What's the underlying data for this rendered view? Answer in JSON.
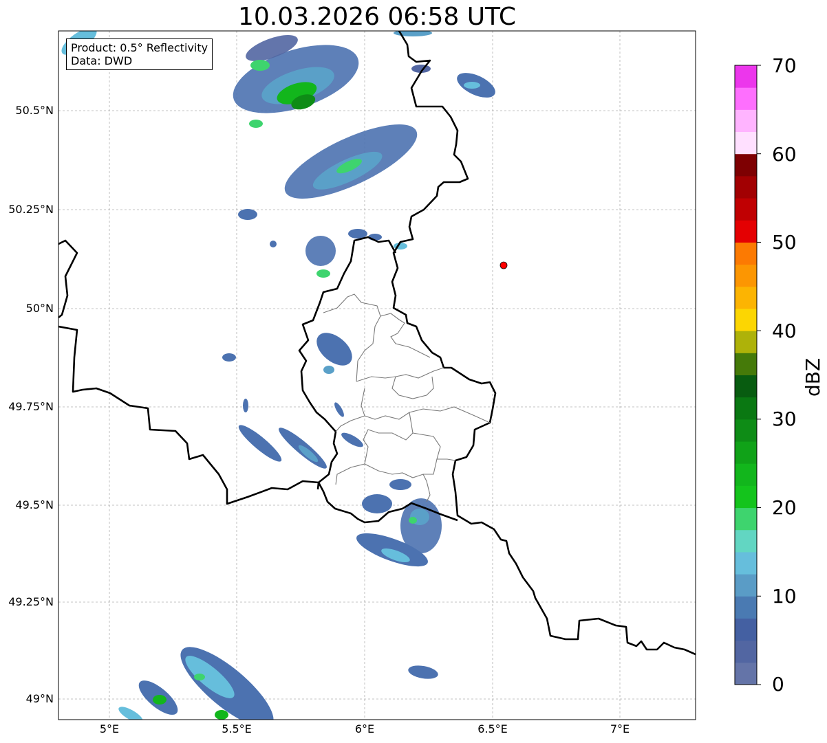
{
  "title": "10.03.2026 06:58 UTC",
  "infobox": {
    "product": "Product: 0.5° Reflectivity",
    "data": "Data: DWD"
  },
  "lat_ticks": [
    "50.5°N",
    "50.25°N",
    "50°N",
    "49.75°N",
    "49.5°N",
    "49.25°N",
    "49°N"
  ],
  "lon_ticks": [
    "5°E",
    "5.5°E",
    "6°E",
    "6.5°E",
    "7°E"
  ],
  "colorbar": {
    "label": "dBZ",
    "ticks": [
      "0",
      "10",
      "20",
      "30",
      "40",
      "50",
      "60",
      "70"
    ],
    "colors": [
      "#6474a8",
      "#5266a2",
      "#4460a2",
      "#4a7ab2",
      "#5a9cc6",
      "#66bedc",
      "#62d6c2",
      "#3ed46e",
      "#14c41c",
      "#12b61c",
      "#10a218",
      "#0e8c16",
      "#0a7812",
      "#085c10",
      "#457a09",
      "#aeb209",
      "#fcd602",
      "#fcb402",
      "#fc9602",
      "#fc7a02",
      "#e40002",
      "#c00002",
      "#a20002",
      "#7e0002",
      "#ffe0ff",
      "#ffb4ff",
      "#fe6ffe",
      "#ec36ec"
    ]
  },
  "marker_color": "#ff0000"
}
